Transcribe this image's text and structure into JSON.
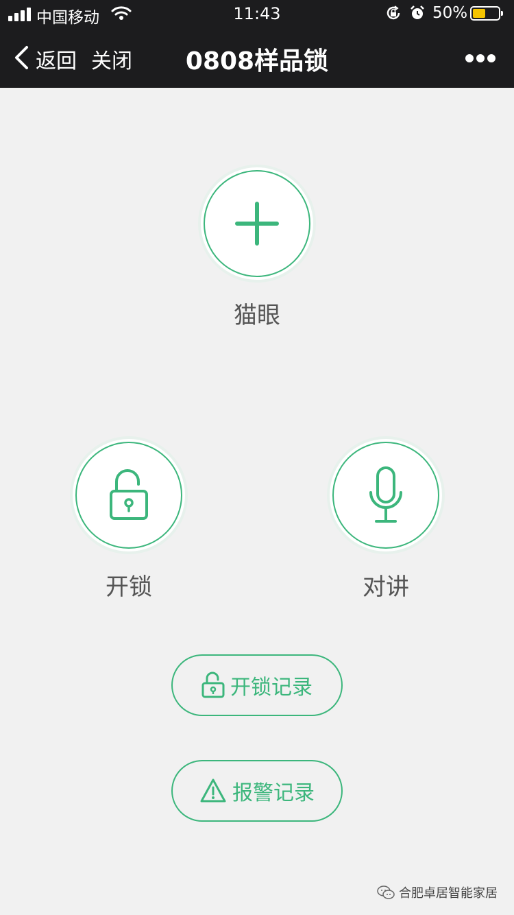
{
  "status_bar": {
    "carrier": "中国移动",
    "time": "11:43",
    "battery_percent": "50%",
    "battery_level": 0.5
  },
  "nav": {
    "back_label": "返回",
    "close_label": "关闭",
    "title": "0808样品锁"
  },
  "actions": {
    "peephole_label": "猫眼",
    "unlock_label": "开锁",
    "intercom_label": "对讲"
  },
  "records": {
    "unlock_records_label": "开锁记录",
    "alarm_records_label": "报警记录"
  },
  "watermark": {
    "text": "合肥卓居智能家居"
  },
  "colors": {
    "accent": "#3cb67c",
    "topbar": "#1c1c1e",
    "background": "#f1f1f1",
    "battery": "#f5c400"
  }
}
